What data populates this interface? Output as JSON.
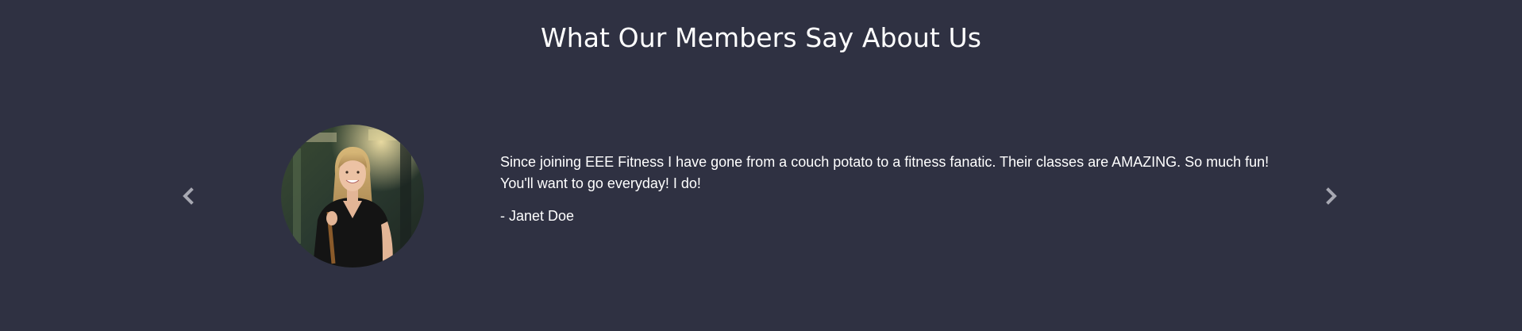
{
  "section": {
    "title": "What Our Members Say About Us"
  },
  "testimonial": {
    "quote": "Since joining EEE Fitness I have gone from a couch potato to a fitness fanatic. Their classes are AMAZING. So much fun! You'll want to go everyday! I do!",
    "author": "- Janet Doe",
    "avatar_icon": "member-photo"
  },
  "controls": {
    "prev_icon": "chevron-left-icon",
    "next_icon": "chevron-right-icon"
  },
  "colors": {
    "background": "#2f3142",
    "text": "#ffffff",
    "arrow": "#a7a8b2"
  }
}
